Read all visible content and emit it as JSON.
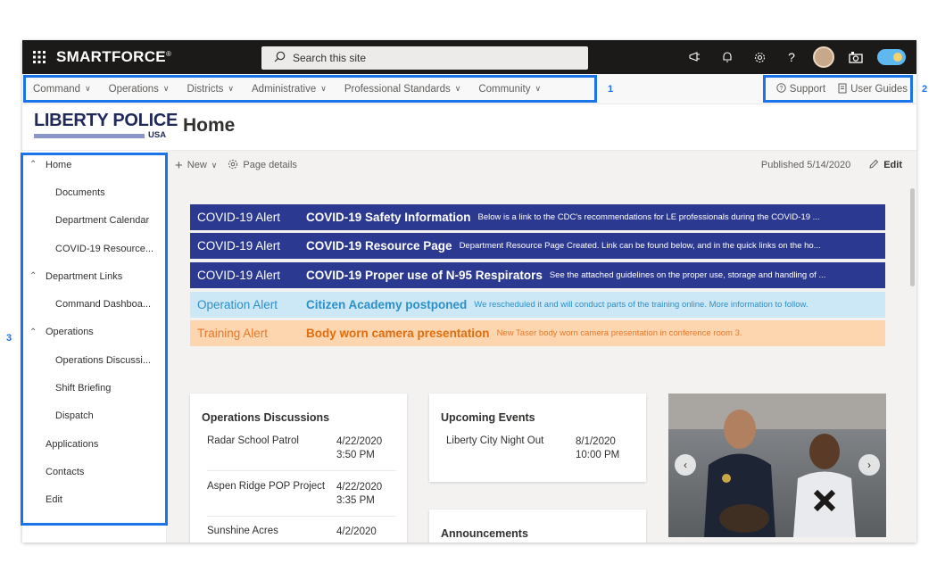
{
  "suite": {
    "brand": "SMARTFORCE",
    "brand_mark": "®",
    "search_placeholder": "Search this site"
  },
  "hub_nav": {
    "items": [
      "Command",
      "Operations",
      "Districts",
      "Administrative",
      "Professional Standards",
      "Community"
    ],
    "support": "Support",
    "user_guides": "User Guides"
  },
  "site": {
    "logo_main": "LIBERTY POLICE",
    "logo_sub": "USA",
    "title": "Home"
  },
  "left_nav": [
    {
      "label": "Home",
      "level": "top",
      "caret": "^"
    },
    {
      "label": "Documents",
      "level": "sub"
    },
    {
      "label": "Department Calendar",
      "level": "sub"
    },
    {
      "label": "COVID-19 Resource...",
      "level": "sub"
    },
    {
      "label": "Department Links",
      "level": "top",
      "caret": "^"
    },
    {
      "label": "Command Dashboa...",
      "level": "sub"
    },
    {
      "label": "Operations",
      "level": "top",
      "caret": "^"
    },
    {
      "label": "Operations Discussi...",
      "level": "sub"
    },
    {
      "label": "Shift Briefing",
      "level": "sub"
    },
    {
      "label": "Dispatch",
      "level": "sub"
    },
    {
      "label": "Applications",
      "level": "plain"
    },
    {
      "label": "Contacts",
      "level": "plain"
    },
    {
      "label": "Edit",
      "level": "plain"
    }
  ],
  "command_bar": {
    "new_label": "New",
    "page_details": "Page details",
    "published": "Published 5/14/2020",
    "edit": "Edit"
  },
  "alerts": [
    {
      "type": "COVID-19 Alert",
      "title": "COVID-19 Safety Information",
      "desc": "Below is a link to the CDC's recommendations for LE professionals during the COVID-19 ...",
      "bg": "#2b3990",
      "fg": "#ffffff",
      "title_color": "#ffffff"
    },
    {
      "type": "COVID-19 Alert",
      "title": "COVID-19 Resource Page",
      "desc": "Department Resource Page Created. Link can be found below, and in the quick links on the ho...",
      "bg": "#2b3990",
      "fg": "#ffffff",
      "title_color": "#ffffff"
    },
    {
      "type": "COVID-19 Alert",
      "title": "COVID-19 Proper use of N-95 Respirators",
      "desc": "See the attached guidelines on the proper use, storage and handling of ...",
      "bg": "#2b3990",
      "fg": "#ffffff",
      "title_color": "#ffffff"
    },
    {
      "type": "Operation Alert",
      "title": "Citizen Academy postponed",
      "desc": "We rescheduled it and will conduct parts of the training online. More information to follow.",
      "bg": "#cce8f6",
      "fg": "#2e8fc7",
      "title_color": "#2e8fc7"
    },
    {
      "type": "Training Alert",
      "title": "Body worn camera presentation",
      "desc": "New Taser body worn camera presentation in conference room 3.",
      "bg": "#fdd6b0",
      "fg": "#e8792b",
      "title_color": "#e06d10"
    }
  ],
  "ops_discussions": {
    "heading": "Operations Discussions",
    "items": [
      {
        "name": "Radar School Patrol",
        "date": "4/22/2020",
        "time": "3:50 PM"
      },
      {
        "name": "Aspen Ridge POP Project",
        "date": "4/22/2020",
        "time": "3:35 PM"
      },
      {
        "name": "Sunshine Acres",
        "date": "4/2/2020",
        "time": ""
      }
    ]
  },
  "upcoming_events": {
    "heading": "Upcoming Events",
    "items": [
      {
        "name": "Liberty City Night Out",
        "date": "8/1/2020",
        "time": "10:00 PM"
      }
    ]
  },
  "announcements": {
    "heading": "Announcements"
  },
  "callouts": {
    "one": "1",
    "two": "2",
    "three": "3"
  }
}
